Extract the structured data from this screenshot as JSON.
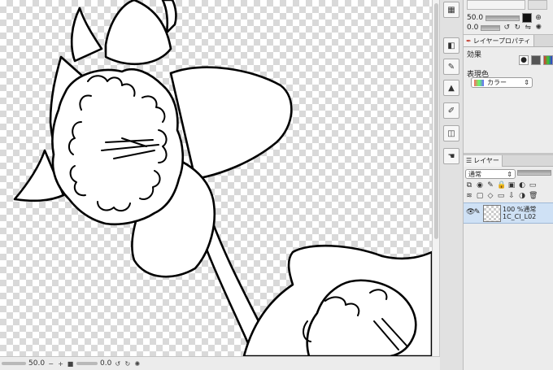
{
  "status_bar": {
    "zoom": "50.0",
    "angle": "0.0"
  },
  "sub_view": {
    "zoom": "50.0",
    "angle": "0.0"
  },
  "properties_panel": {
    "tab_label": "レイヤープロパティ",
    "effect_label": "効果",
    "display_color_label": "表現色",
    "display_color_value": "カラー"
  },
  "layer_panel": {
    "tab_label": "レイヤー",
    "blend_mode": "通常",
    "layers": [
      {
        "info": "100 %通常",
        "name": "1C_CI_L02"
      }
    ]
  },
  "colors": {
    "selection": "#cfe1f5",
    "panel_bg": "#ececec",
    "checker": "#d9d9d9",
    "line_art": "#000000"
  }
}
